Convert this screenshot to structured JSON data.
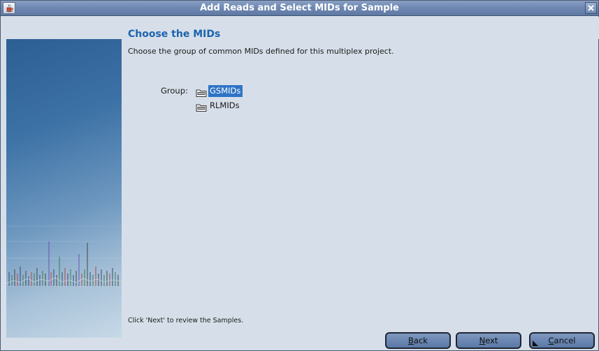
{
  "window": {
    "title": "Add Reads and Select MIDs for Sample"
  },
  "page": {
    "heading": "Choose the MIDs",
    "description": "Choose the group of common MIDs defined for this multiplex project.",
    "group_label": "Group:",
    "groups": [
      {
        "label": "GSMIDs",
        "selected": true
      },
      {
        "label": "RLMIDs",
        "selected": false
      }
    ],
    "footer_note": "Click 'Next' to review the Samples."
  },
  "buttons": {
    "back": {
      "mnemonic": "B",
      "rest": "ack"
    },
    "next": {
      "mnemonic": "N",
      "rest": "ext"
    },
    "cancel": {
      "mnemonic": "C",
      "rest": "ancel"
    }
  },
  "icons": {
    "app": "java-cup-icon",
    "close": "close-icon",
    "group_item": "folder-icon"
  },
  "colors": {
    "heading": "#1b63ad",
    "selection": "#2f73c6",
    "titlebar": "#6f89b3",
    "background": "#d6dfe9"
  }
}
